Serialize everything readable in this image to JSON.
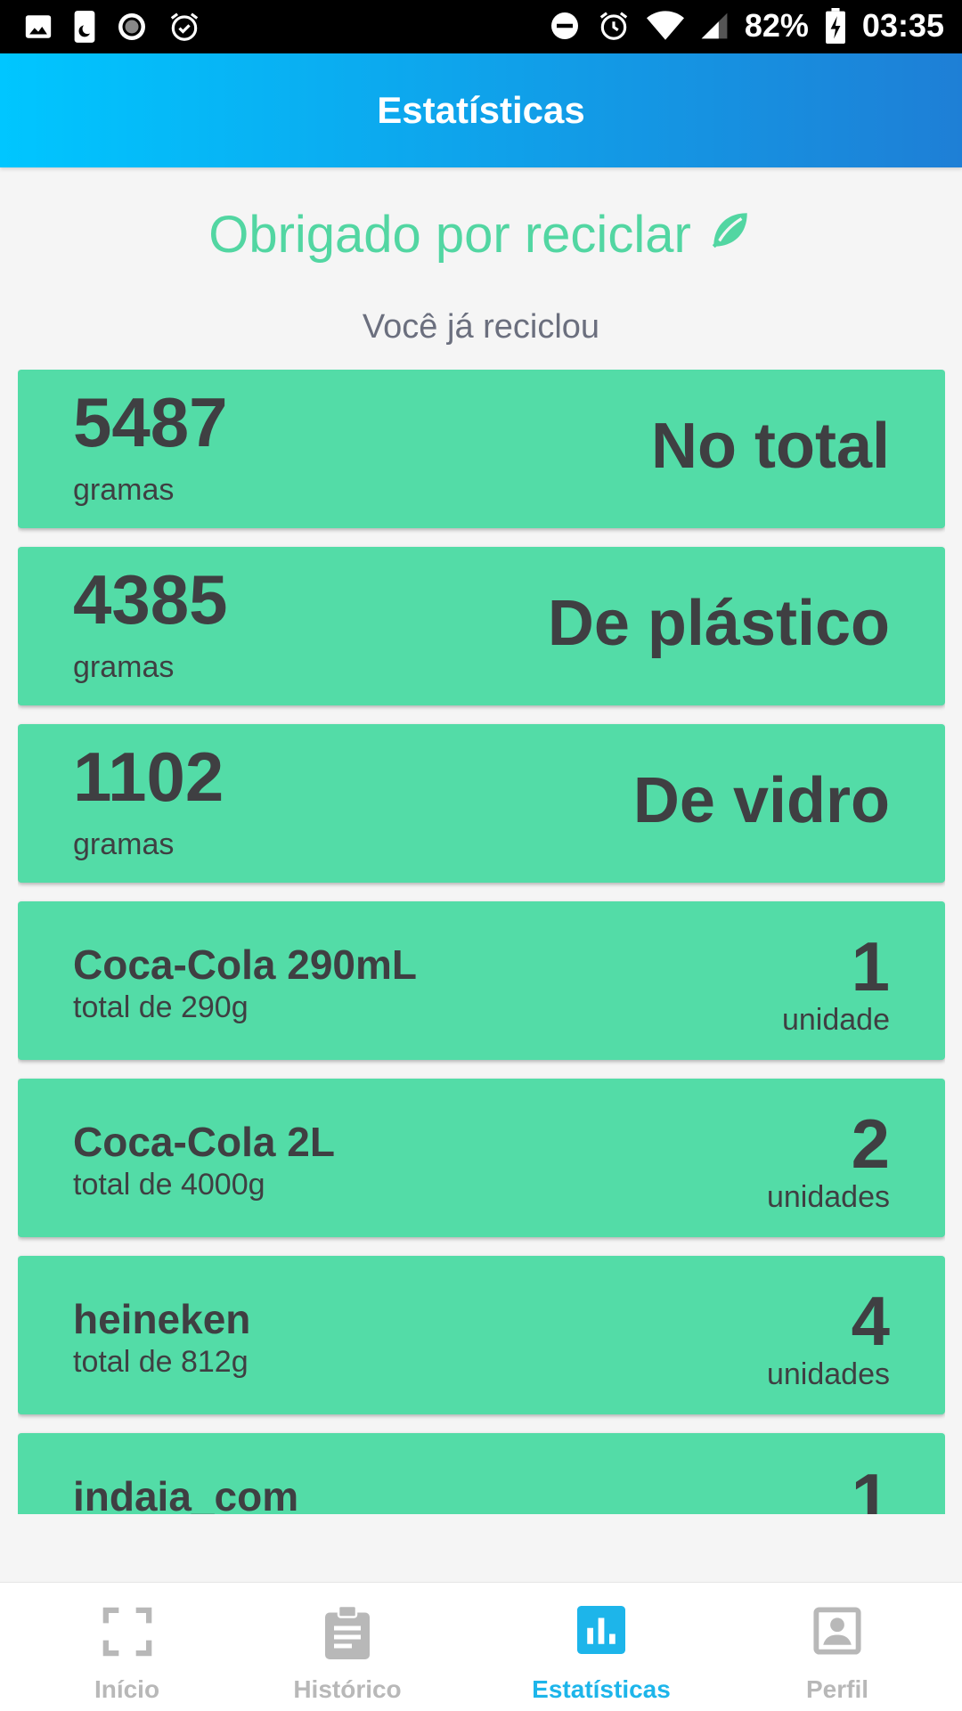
{
  "status_bar": {
    "battery": "82%",
    "time": "03:35",
    "left_icons": [
      "image-icon",
      "phone-moon-icon",
      "record-icon",
      "alarm-check-icon"
    ],
    "right_icons": [
      "dnd-icon",
      "alarm-icon",
      "wifi-icon",
      "signal-icon",
      "battery-charging-icon"
    ]
  },
  "app_bar": {
    "title": "Estatísticas"
  },
  "header": {
    "thanks": "Obrigado por reciclar",
    "thanks_icon": "leaf-icon",
    "subtitle": "Você já reciclou"
  },
  "summary_cards": [
    {
      "value": "5487",
      "unit": "gramas",
      "label": "No total"
    },
    {
      "value": "4385",
      "unit": "gramas",
      "label": "De plástico"
    },
    {
      "value": "1102",
      "unit": "gramas",
      "label": "De vidro"
    }
  ],
  "product_cards": [
    {
      "name": "Coca-Cola 290mL",
      "total": "total de 290g",
      "quantity": "1",
      "quantity_unit": "unidade"
    },
    {
      "name": "Coca-Cola 2L",
      "total": "total de 4000g",
      "quantity": "2",
      "quantity_unit": "unidades"
    },
    {
      "name": "heineken",
      "total": "total de 812g",
      "quantity": "4",
      "quantity_unit": "unidades"
    },
    {
      "name": "indaia_com",
      "total": "",
      "quantity": "1",
      "quantity_unit": ""
    }
  ],
  "bottom_nav": {
    "items": [
      {
        "label": "Início",
        "icon": "scan-icon",
        "active": false
      },
      {
        "label": "Histórico",
        "icon": "clipboard-icon",
        "active": false
      },
      {
        "label": "Estatísticas",
        "icon": "bar-chart-icon",
        "active": true
      },
      {
        "label": "Perfil",
        "icon": "profile-icon",
        "active": false
      }
    ]
  },
  "colors": {
    "accent": "#1db5ea",
    "card": "#53dca7",
    "thanks_text": "#52d6a2",
    "appbar_start": "#00c6ff",
    "appbar_end": "#1e7fd6"
  }
}
